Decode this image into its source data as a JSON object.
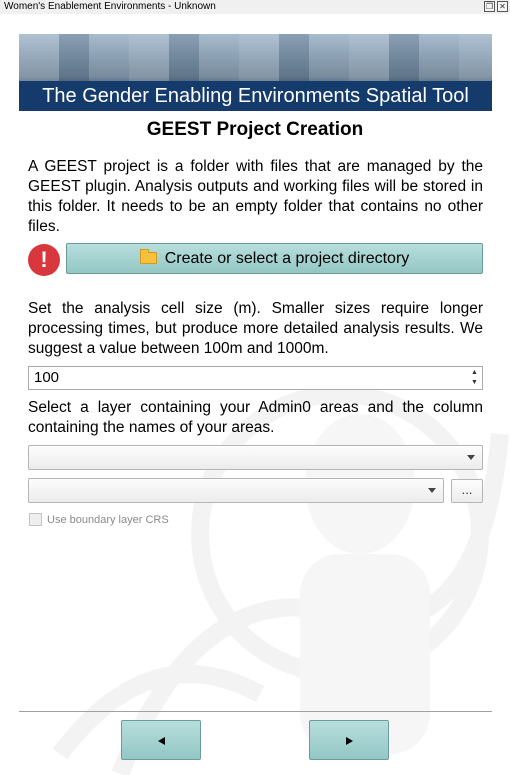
{
  "window": {
    "title": "Women's Enablement Environments - Unknown",
    "restore_glyph": "❐",
    "close_glyph": "✕"
  },
  "banner": {
    "title": "The Gender Enabling Environments Spatial Tool"
  },
  "page": {
    "heading": "GEEST Project Creation",
    "intro": "A GEEST project is a folder with files that are managed by the GEEST plugin. Analysis outputs and working files will be stored in this folder. It needs to be an empty folder that contains no other files.",
    "alert_glyph": "!",
    "project_button_label": "Create or select a project directory",
    "cell_size_text": "Set the analysis cell size (m). Smaller sizes require longer processing times, but produce more detailed analysis results. We suggest a value between 100m and 1000m.",
    "cell_size_value": "100",
    "admin_text": "Select a layer containing your Admin0 areas and the column containing the names of your areas.",
    "layer_combo_value": "",
    "field_combo_value": "",
    "browse_label": "...",
    "boundary_crs_label": "Use boundary layer CRS",
    "boundary_crs_checked": false
  },
  "icons": {
    "alert": "error-circle-icon",
    "folder": "folder-icon",
    "prev": "arrow-left-icon",
    "next": "arrow-right-icon"
  },
  "colors": {
    "banner_bar": "#143b6b",
    "teal_button": "#93c7c4",
    "alert": "#d8373d"
  }
}
